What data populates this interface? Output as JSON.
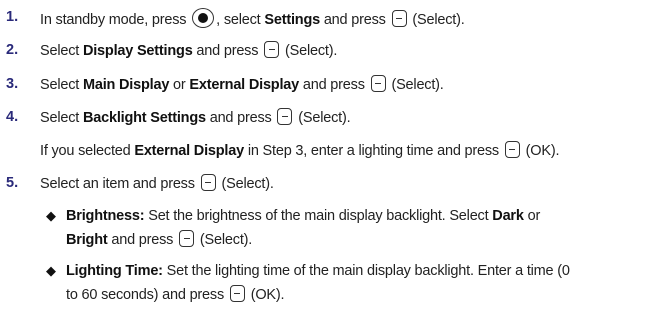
{
  "steps": [
    {
      "num": "1.",
      "t1": "In standby mode, press",
      "t2": ", select",
      "b1": "Settings",
      "t3": "and press",
      "t4": "(Select)."
    },
    {
      "num": "2.",
      "t1": "Select",
      "b1": "Display Settings",
      "t2": "and press",
      "t3": "(Select)."
    },
    {
      "num": "3.",
      "t1": "Select",
      "b1": "Main Display",
      "t2": "or",
      "b2": "External Display",
      "t3": "and press",
      "t4": "(Select)."
    },
    {
      "num": "4.",
      "t1": "Select",
      "b1": "Backlight Settings",
      "t2": "and press",
      "t3": "(Select)."
    },
    {
      "num": "5.",
      "t1": "Select an item and press",
      "t2": "(Select)."
    }
  ],
  "note4": {
    "t1": "If you selected",
    "b1": "External Display",
    "t2": "in Step 3, enter a lighting time and press",
    "t3": "(OK)."
  },
  "bullets": [
    {
      "bold": "Brightness:",
      "t1": "Set the brightness of the main display backlight. Select",
      "b1": "Dark",
      "t2": "or",
      "b2": "Bright",
      "t3": "and press",
      "t4": "(Select)."
    },
    {
      "bold": "Lighting Time:",
      "t1": "Set the lighting time of the main display backlight. Enter a time (0",
      "t2": "to 60 seconds) and press",
      "t3": "(OK)."
    }
  ],
  "icons": {
    "bullet": "◆",
    "softkey": "softkey-minus-icon",
    "navkey": "nav-center-key-icon"
  }
}
